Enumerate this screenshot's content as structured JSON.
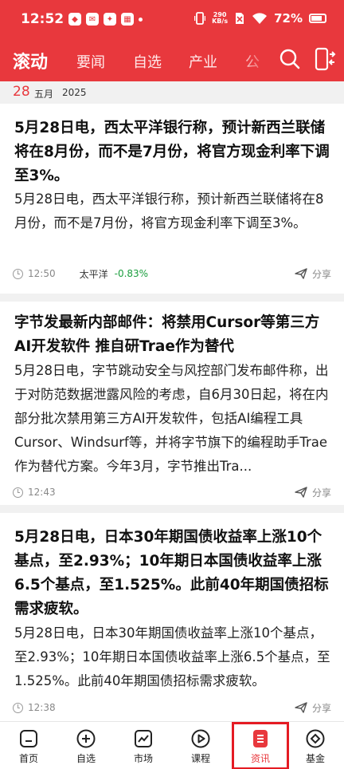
{
  "status_bar": {
    "time": "12:52",
    "battery": "72%",
    "net_speed_value": "290",
    "net_speed_unit": "KB/s"
  },
  "nav": {
    "tabs": [
      "滚动",
      "要闻",
      "自选",
      "产业",
      "公"
    ],
    "active_tab": "滚动"
  },
  "date_header": {
    "day": "28",
    "month": "五月",
    "year": "2025"
  },
  "articles": [
    {
      "title": "5月28日电，西太平洋银行称，预计新西兰联储将在8月份，而不是7月份，将官方现金利率下调至3%。",
      "body": "5月28日电，西太平洋银行称，预计新西兰联储将在8月份，而不是7月份，将官方现金利率下调至3%。",
      "time": "12:50",
      "stock_name": "太平洋",
      "stock_change": "-0.83%",
      "share_label": "分享"
    },
    {
      "title": "字节发最新内部邮件：将禁用Cursor等第三方AI开发软件 推自研Trae作为替代",
      "body": "5月28日电，字节跳动安全与风控部门发布邮件称，出于对防范数据泄露风险的考虑，自6月30日起，将在内部分批次禁用第三方AI开发软件，包括AI编程工具Cursor、Windsurf等，并将字节旗下的编程助手Trae作为替代方案。今年3月，字节推出Tra...",
      "time": "12:43",
      "share_label": "分享"
    },
    {
      "title": "5月28日电，日本30年期国债收益率上涨10个基点，至2.93%；10年期日本国债收益率上涨6.5个基点，至1.525%。此前40年期国债招标需求疲软。",
      "body": "5月28日电，日本30年期国债收益率上涨10个基点，至2.93%；10年期日本国债收益率上涨6.5个基点，至1.525%。此前40年期国债招标需求疲软。",
      "time": "12:38",
      "share_label": "分享"
    }
  ],
  "bottom_nav": [
    {
      "label": "首页",
      "icon": "home-icon"
    },
    {
      "label": "自选",
      "icon": "plus-circle-icon"
    },
    {
      "label": "市场",
      "icon": "chart-icon"
    },
    {
      "label": "课程",
      "icon": "play-icon"
    },
    {
      "label": "资讯",
      "icon": "news-icon",
      "active": true
    },
    {
      "label": "基金",
      "icon": "diamond-icon"
    }
  ],
  "colors": {
    "brand_red": "#e8383d",
    "gain_green": "#1b9e3e"
  }
}
